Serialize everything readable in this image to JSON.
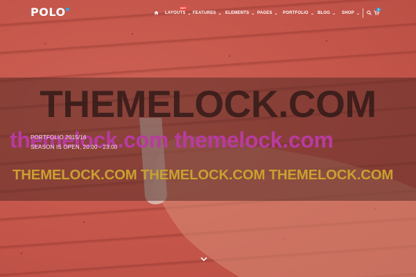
{
  "header": {
    "logo": "POLO",
    "menu": [
      {
        "label": "LAYOUTS",
        "badge": "HOT"
      },
      {
        "label": "FEATURES"
      },
      {
        "label": "ELEMENTS"
      },
      {
        "label": "PAGES"
      },
      {
        "label": "PORTFOLIO"
      },
      {
        "label": "BLOG"
      },
      {
        "label": "SHOP"
      }
    ],
    "cart_count": "0"
  },
  "hero": {
    "subtitle": "PORTFOLIO 2015/16",
    "tagline": "SEASON IS OPEN, 20:00 - 23:00"
  },
  "watermarks": {
    "large": "THEMELOCK.COM",
    "medium": "themelock.com themelock.com",
    "small": "THEMELOCK.COM THEMELOCK.COM THEMELOCK.COM"
  },
  "colors": {
    "accent": "#2aa9e0",
    "hot_badge": "#e8473f",
    "background": "#c8584d",
    "watermark_pink": "#b93aa1",
    "watermark_gold": "#c9a12f"
  }
}
